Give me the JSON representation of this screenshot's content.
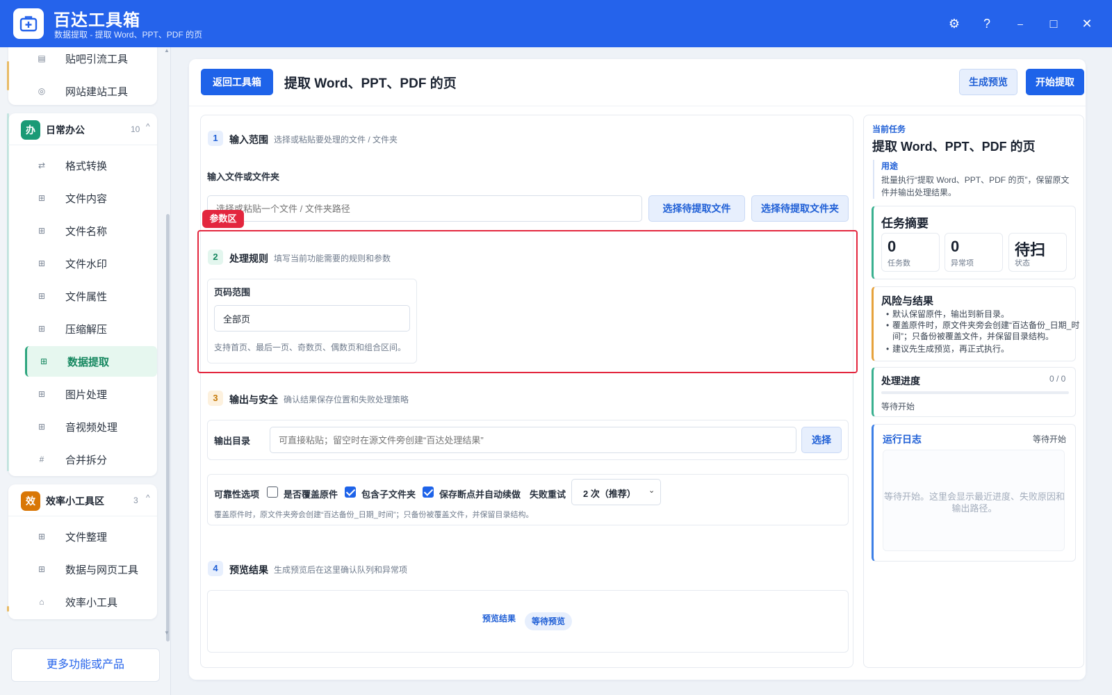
{
  "app": {
    "title": "百达工具箱",
    "subtitle": "数据提取 - 提取 Word、PPT、PDF 的页"
  },
  "window_controls": {
    "settings": "⚙",
    "help": "?",
    "minimize": "–",
    "maximize": "□",
    "close": "✕"
  },
  "sidebar": {
    "group0_items": [
      {
        "label": "贴吧引流工具",
        "icon": "list-icon"
      },
      {
        "label": "网站建站工具",
        "icon": "globe-icon"
      }
    ],
    "group1": {
      "badge": "办",
      "title": "日常办公",
      "count": "10",
      "caret": "^",
      "badge_color": "#1a9a76",
      "items": [
        {
          "label": "格式转换",
          "icon": "swap-icon"
        },
        {
          "label": "文件内容",
          "icon": "grid-icon"
        },
        {
          "label": "文件名称",
          "icon": "grid-icon"
        },
        {
          "label": "文件水印",
          "icon": "grid-icon"
        },
        {
          "label": "文件属性",
          "icon": "grid-icon"
        },
        {
          "label": "压缩解压",
          "icon": "grid-icon"
        },
        {
          "label": "数据提取",
          "icon": "grid-icon",
          "active": true
        },
        {
          "label": "图片处理",
          "icon": "grid-icon"
        },
        {
          "label": "音视频处理",
          "icon": "grid-icon"
        },
        {
          "label": "合并拆分",
          "icon": "hash-icon"
        }
      ]
    },
    "group2": {
      "badge": "效",
      "title": "效率小工具区",
      "count": "3",
      "caret": "^",
      "badge_color": "#d97706",
      "items": [
        {
          "label": "文件整理",
          "icon": "grid-icon"
        },
        {
          "label": "数据与网页工具",
          "icon": "grid-icon"
        },
        {
          "label": "效率小工具",
          "icon": "toolbox-icon"
        }
      ]
    },
    "more_label": "更多功能或产品"
  },
  "toolbar": {
    "back_label": "返回工具箱",
    "page_title": "提取 Word、PPT、PDF 的页",
    "preview_label": "生成预览",
    "start_label": "开始提取"
  },
  "step1": {
    "num": "1",
    "title": "输入范围",
    "desc": "选择或粘贴要处理的文件 / 文件夹",
    "field_label": "输入文件或文件夹",
    "input_placeholder": "选择或粘贴一个文件 / 文件夹路径",
    "choose_file_label": "选择待提取文件",
    "choose_folder_label": "选择待提取文件夹"
  },
  "param_tag": "参数区",
  "step2": {
    "num": "2",
    "title": "处理规则",
    "desc": "填写当前功能需要的规则和参数",
    "page_range_label": "页码范围",
    "page_range_value": "全部页",
    "page_range_hint": "支持首页、最后一页、奇数页、偶数页和组合区间。"
  },
  "step3": {
    "num": "3",
    "title": "输出与安全",
    "desc": "确认结果保存位置和失败处理策略",
    "output_label": "输出目录",
    "output_placeholder": "可直接粘贴；留空时在源文件旁创建“百达处理结果”",
    "choose_label": "选择",
    "reliability_label": "可靠性选项",
    "opt_overwrite": "是否覆盖原件",
    "opt_overwrite_checked": false,
    "opt_subfolders": "包含子文件夹",
    "opt_subfolders_checked": true,
    "opt_resume": "保存断点并自动续做",
    "opt_resume_checked": true,
    "retry_label": "失败重试",
    "retry_value": "2 次（推荐）",
    "note": "覆盖原件时，原文件夹旁会创建“百达备份_日期_时间”；只备份被覆盖文件，并保留目录结构。"
  },
  "step4": {
    "num": "4",
    "title": "预览结果",
    "desc": "生成预览后在这里确认队列和异常项",
    "result_label": "预览结果",
    "result_badge": "等待预览"
  },
  "right_panel": {
    "current_task_label": "当前任务",
    "task_title": "提取 Word、PPT、PDF 的页",
    "purpose_label": "用途",
    "purpose_text": "批量执行“提取 Word、PPT、PDF 的页”，保留原文件并输出处理结果。",
    "summary_title": "任务摘要",
    "stats": [
      {
        "value": "0",
        "label": "任务数"
      },
      {
        "value": "0",
        "label": "异常项"
      },
      {
        "value": "待扫",
        "label": "状态"
      }
    ],
    "risk_title": "风险与结果",
    "risk_items": [
      "默认保留原件，输出到新目录。",
      "覆盖原件时，原文件夹旁会创建“百达备份_日期_时间”；只备份被覆盖文件，并保留目录结构。",
      "建议先生成预览，再正式执行。"
    ],
    "progress_title": "处理进度",
    "progress_count": "0 / 0",
    "progress_value": 0,
    "progress_status": "等待开始",
    "log_title": "运行日志",
    "log_status": "等待开始",
    "log_placeholder": "等待开始。这里会显示最近进度、失败原因和输出路径。"
  },
  "colors": {
    "brand": "#2563eb",
    "active_green": "#15875f",
    "param_red": "#e3263e"
  }
}
